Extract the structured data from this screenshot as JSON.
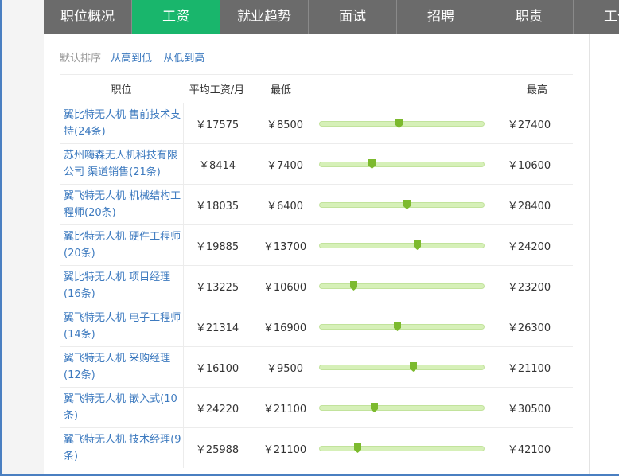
{
  "tabs": [
    {
      "label": "职位概况",
      "active": false
    },
    {
      "label": "工资",
      "active": true
    },
    {
      "label": "就业趋势",
      "active": false
    },
    {
      "label": "面试",
      "active": false
    },
    {
      "label": "招聘",
      "active": false
    },
    {
      "label": "职责",
      "active": false
    },
    {
      "label": "工作",
      "active": false
    }
  ],
  "sort": {
    "label": "默认排序",
    "high_to_low": "从高到低",
    "low_to_high": "从低到高"
  },
  "table": {
    "headers": {
      "position": "职位",
      "avg": "平均工资/月",
      "min": "最低",
      "max": "最高"
    },
    "rows": [
      {
        "name": "翼比特无人机 售前技术支持(24条)",
        "avg": "￥17575",
        "min": "￥8500",
        "max": "￥27400",
        "avg_value": 17575,
        "min_value": 8500,
        "max_value": 27400
      },
      {
        "name": "苏州嗨森无人机科技有限公司 渠道销售(21条)",
        "avg": "￥8414",
        "min": "￥7400",
        "max": "￥10600",
        "avg_value": 8414,
        "min_value": 7400,
        "max_value": 10600
      },
      {
        "name": "翼飞特无人机 机械结构工程师(20条)",
        "avg": "￥18035",
        "min": "￥6400",
        "max": "￥28400",
        "avg_value": 18035,
        "min_value": 6400,
        "max_value": 28400
      },
      {
        "name": "翼比特无人机 硬件工程师(20条)",
        "avg": "￥19885",
        "min": "￥13700",
        "max": "￥24200",
        "avg_value": 19885,
        "min_value": 13700,
        "max_value": 24200
      },
      {
        "name": "翼比特无人机 项目经理(16条)",
        "avg": "￥13225",
        "min": "￥10600",
        "max": "￥23200",
        "avg_value": 13225,
        "min_value": 10600,
        "max_value": 23200
      },
      {
        "name": "翼飞特无人机 电子工程师(14条)",
        "avg": "￥21314",
        "min": "￥16900",
        "max": "￥26300",
        "avg_value": 21314,
        "min_value": 16900,
        "max_value": 26300
      },
      {
        "name": "翼飞特无人机 采购经理(12条)",
        "avg": "￥16100",
        "min": "￥9500",
        "max": "￥21100",
        "avg_value": 16100,
        "min_value": 9500,
        "max_value": 21100
      },
      {
        "name": "翼飞特无人机 嵌入式(10条)",
        "avg": "￥24220",
        "min": "￥21100",
        "max": "￥30500",
        "avg_value": 24220,
        "min_value": 21100,
        "max_value": 30500
      },
      {
        "name": "翼飞特无人机 技术经理(9条)",
        "avg": "￥25988",
        "min": "￥21100",
        "max": "￥42100",
        "avg_value": 25988,
        "min_value": 21100,
        "max_value": 42100
      }
    ]
  },
  "colors": {
    "tab_active": "#19b66c",
    "tab_bg": "#6b6b6b",
    "link": "#3d7abf",
    "bar_track": "#d6f0b8",
    "marker": "#7cba2e"
  }
}
